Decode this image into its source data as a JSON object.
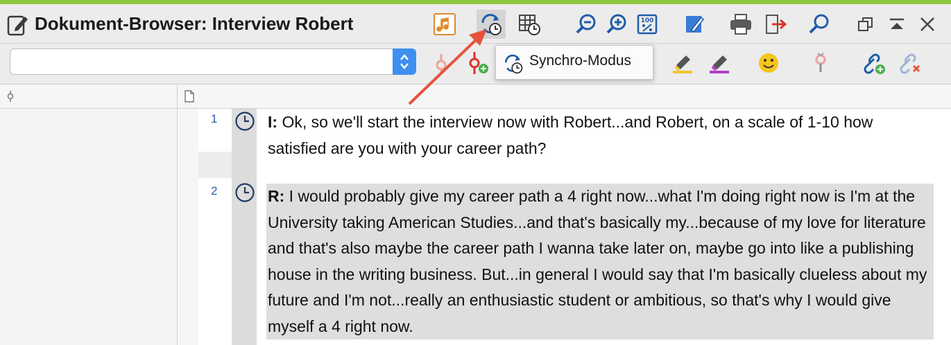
{
  "window": {
    "title": "Dokument-Browser: Interview Robert"
  },
  "tooltip": {
    "label": "Synchro-Modus"
  },
  "combo": {
    "value": ""
  },
  "segments": [
    {
      "number": "1",
      "speaker": "I:",
      "text": " Ok, so we'll start the interview now with Robert...and Robert, on a scale of 1-10 how satisfied are you with your career path?"
    },
    {
      "number": "2",
      "speaker": "R:",
      "text": " I would probably give my career path a 4 right now...what I'm doing right now is I'm at the University taking American Studies...and that's basically my...because of my love for literature and that's also maybe the career path I wanna take later on, maybe go into like a publishing house in the writing business. But...in general I would say that I'm basically clueless about my future and I'm not...really an enthusiastic student or ambitious, so that's why I would give myself a 4 right now."
    }
  ],
  "colors": {
    "accent_green": "#8cc63f",
    "icon_blue": "#1f5ca8",
    "arrow_red": "#e5533d",
    "selection_gray": "#dedede"
  },
  "icons": {
    "toolbar1": [
      "music-icon",
      "sync-icon",
      "table-clock-icon",
      "zoom-out-icon",
      "zoom-in-icon",
      "percent-icon",
      "memo-icon",
      "print-icon",
      "export-icon",
      "search-icon",
      "window-restore-icon",
      "collapse-icon",
      "close-icon"
    ],
    "toolbar2": [
      "code-pin-icon",
      "code-add-icon",
      "highlighter-yellow-icon",
      "highlighter-purple-icon",
      "smiley-icon",
      "code-pin-gray-icon",
      "link-add-icon",
      "link-remove-icon"
    ]
  }
}
